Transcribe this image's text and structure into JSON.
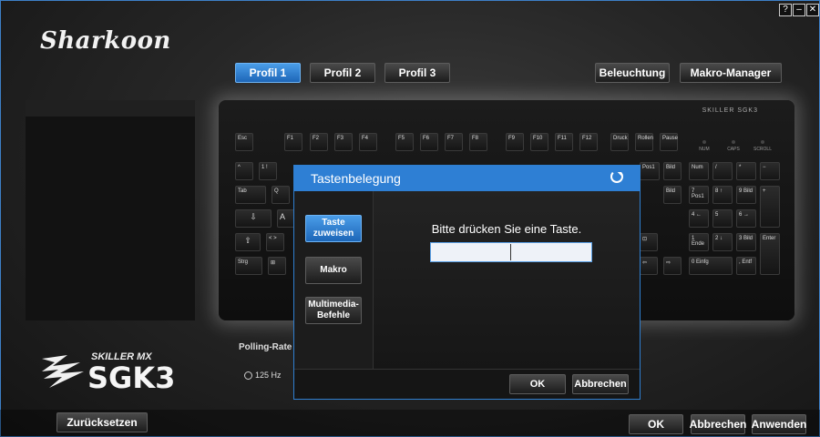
{
  "window_controls": {
    "help": "?",
    "minimize": "–",
    "close": "✕"
  },
  "brand": {
    "logo_text": "Sharkoon",
    "series": "SKILLER MX",
    "model": "SGK3"
  },
  "profiles": [
    {
      "label": "Profil 1",
      "active": true
    },
    {
      "label": "Profil 2",
      "active": false
    },
    {
      "label": "Profil 3",
      "active": false
    }
  ],
  "top_right": {
    "lighting": "Beleuchtung",
    "macro_manager": "Makro-Manager"
  },
  "keyboard": {
    "brand_label": "SKILLER SGK3",
    "leds": [
      "NUM",
      "CAPS",
      "SCROLL"
    ],
    "row0": [
      "Esc",
      "F1",
      "F2",
      "F3",
      "F4",
      "F5",
      "F6",
      "F7",
      "F8",
      "F9",
      "F10",
      "F11",
      "F12",
      "Druck",
      "Rollen",
      "Pause"
    ],
    "row1": [
      "^",
      "1 !",
      "",
      ""
    ],
    "row2": [
      "Tab",
      "Q"
    ],
    "row3": [
      "⇩",
      "A"
    ],
    "row4": [
      "⇧",
      "< >"
    ],
    "row5": [
      "Strg",
      "⊞"
    ],
    "numpad": [
      "Num",
      "/",
      "*",
      "−",
      "7 Pos1",
      "8 ↑",
      "9 Bild",
      "+",
      "4 ←",
      "5",
      "6 →",
      "1 Ende",
      "2 ↓",
      "3 Bild",
      "Enter",
      "0 Einfg",
      ", Entf"
    ],
    "nav_snippets": [
      "Pos1",
      "Bild",
      "Bild",
      "⊡",
      "⇦",
      "⇨"
    ]
  },
  "polling": {
    "label": "Polling-Rate",
    "options": [
      "125 Hz"
    ]
  },
  "bottom": {
    "reset": "Zurücksetzen",
    "ok": "OK",
    "cancel": "Abbrechen",
    "apply": "Anwenden"
  },
  "dialog": {
    "title": "Tastenbelegung",
    "tabs": [
      {
        "label": "Taste zuweisen",
        "active": true
      },
      {
        "label": "Makro",
        "active": false
      },
      {
        "label": "Multimedia-Befehle",
        "active": false
      }
    ],
    "prompt": "Bitte drücken Sie eine Taste.",
    "input_value": "",
    "ok": "OK",
    "cancel": "Abbrechen"
  },
  "colors": {
    "accent": "#2e7fd4",
    "background": "#262626"
  }
}
